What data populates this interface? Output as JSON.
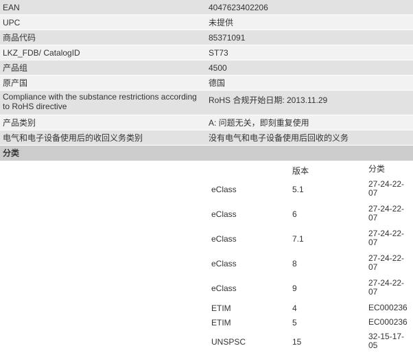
{
  "attributes": [
    {
      "key": "EAN",
      "value": "4047623402206"
    },
    {
      "key": "UPC",
      "value": "未提供"
    },
    {
      "key": "商品代码",
      "value": "85371091"
    },
    {
      "key": "LKZ_FDB/ CatalogID",
      "value": "ST73"
    },
    {
      "key": "产品组",
      "value": "4500"
    },
    {
      "key": "原产国",
      "value": "德国"
    },
    {
      "key": "Compliance with the substance restrictions according to RoHS directive",
      "value": "RoHS 合规开始日期: 2013.11.29"
    },
    {
      "key": "产品类别",
      "value": "A: 问题无关，即刻重复使用"
    },
    {
      "key": "电气和电子设备使用后的收回义务类别",
      "value": "没有电气和电子设备使用后回收的义务"
    }
  ],
  "classification": {
    "section_title": "分类",
    "headers": {
      "system": "",
      "version": "版本",
      "class": "分类"
    },
    "rows": [
      {
        "system": "eClass",
        "version": "5.1",
        "class": "27-24-22-07"
      },
      {
        "system": "eClass",
        "version": "6",
        "class": "27-24-22-07"
      },
      {
        "system": "eClass",
        "version": "7.1",
        "class": "27-24-22-07"
      },
      {
        "system": "eClass",
        "version": "8",
        "class": "27-24-22-07"
      },
      {
        "system": "eClass",
        "version": "9",
        "class": "27-24-22-07"
      },
      {
        "system": "ETIM",
        "version": "4",
        "class": "EC000236"
      },
      {
        "system": "ETIM",
        "version": "5",
        "class": "EC000236"
      },
      {
        "system": "UNSPSC",
        "version": "15",
        "class": "32-15-17-05"
      }
    ]
  }
}
